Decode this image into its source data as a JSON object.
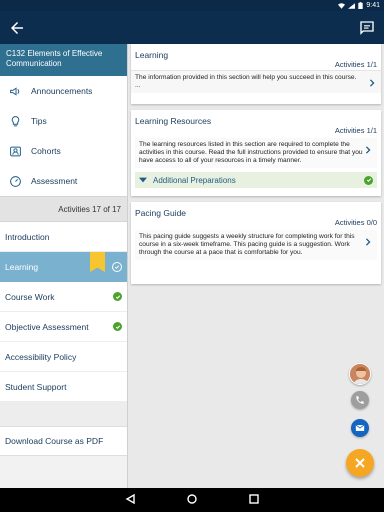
{
  "status_bar": {
    "time": "9:41"
  },
  "course": {
    "title": "C132 Elements of Effective Communication"
  },
  "nav": {
    "items": [
      {
        "label": "Announcements",
        "icon": "megaphone-icon"
      },
      {
        "label": "Tips",
        "icon": "lightbulb-icon"
      },
      {
        "label": "Cohorts",
        "icon": "people-icon"
      },
      {
        "label": "Assessment",
        "icon": "speedometer-icon"
      }
    ]
  },
  "activities_summary": "Activities 17 of 17",
  "sections": [
    {
      "label": "Introduction",
      "status": "none"
    },
    {
      "label": "Learning",
      "status": "active-complete",
      "bookmarked": true
    },
    {
      "label": "Course Work",
      "status": "complete"
    },
    {
      "label": "Objective Assessment",
      "status": "complete"
    },
    {
      "label": "Accessibility Policy",
      "status": "none"
    },
    {
      "label": "Student Support",
      "status": "none"
    }
  ],
  "download_label": "Download Course as PDF",
  "content": {
    "learning": {
      "title": "Learning",
      "activities": "Activities 1/1",
      "text": "The information provided in this section will help you succeed in this course.",
      "ellipsis": "..."
    },
    "resources": {
      "title": "Learning Resources",
      "activities": "Activities 1/1",
      "text": "The learning resources listed in this section are required to complete the activities in this course. Read the full instructions provided to ensure that you have access to all of your resources in a timely manner.",
      "sub_label": "Additional Preparations"
    },
    "pacing": {
      "title": "Pacing Guide",
      "activities": "Activities 0/0",
      "text": "This pacing guide suggests a weekly structure for completing work for this course in a six-week timeframe. This pacing guide is a suggestion. Work through the course at a pace that is comfortable for you."
    }
  },
  "colors": {
    "app_bar": "#0d2d4f",
    "course_header": "#2f6f90",
    "active_section": "#79b1cf",
    "check_green": "#4aa32d",
    "fab_orange": "#f5a623",
    "mail_blue": "#1565c0"
  }
}
